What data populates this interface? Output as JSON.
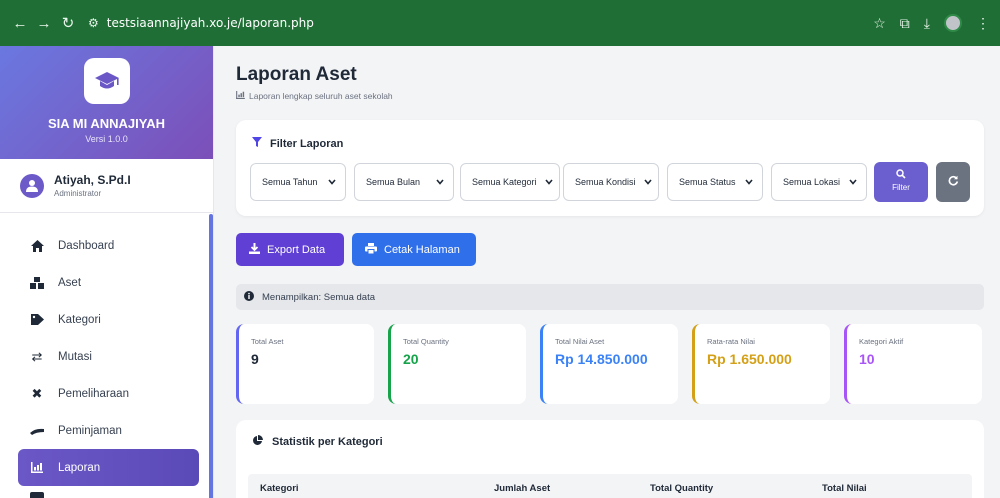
{
  "browser": {
    "url": "testsiaannajiyah.xo.je/laporan.php"
  },
  "sidebar": {
    "brand_name": "SIA MI ANNAJIYAH",
    "version": "Versi 1.0.0",
    "user_name": "Atiyah, S.Pd.I",
    "user_role": "Administrator",
    "menu": [
      {
        "label": "Dashboard",
        "icon": "home-icon"
      },
      {
        "label": "Aset",
        "icon": "boxes-icon"
      },
      {
        "label": "Kategori",
        "icon": "tag-icon"
      },
      {
        "label": "Mutasi",
        "icon": "exchange-icon"
      },
      {
        "label": "Pemeliharaan",
        "icon": "tools-icon"
      },
      {
        "label": "Peminjaman",
        "icon": "hand-icon"
      },
      {
        "label": "Laporan",
        "icon": "chart-icon"
      }
    ]
  },
  "page": {
    "title": "Laporan Aset",
    "subtitle": "Laporan lengkap seluruh aset sekolah"
  },
  "filter": {
    "title": "Filter Laporan",
    "selects": [
      "Semua Tahun",
      "Semua Bulan",
      "Semua Kategori",
      "Semua Kondisi",
      "Semua Status",
      "Semua Lokasi"
    ],
    "filter_button": "Filter"
  },
  "actions": {
    "export": "Export Data",
    "print": "Cetak Halaman"
  },
  "info": "Menampilkan: Semua data",
  "stats": [
    {
      "label": "Total Aset",
      "value": "9",
      "color": "#6366f1"
    },
    {
      "label": "Total Quantity",
      "value": "20",
      "color": "#16a34a"
    },
    {
      "label": "Total Nilai Aset",
      "value": "Rp 14.850.000",
      "color": "#3b82f6"
    },
    {
      "label": "Rata-rata Nilai",
      "value": "Rp 1.650.000",
      "color": "#d4a017"
    },
    {
      "label": "Kategori Aktif",
      "value": "10",
      "color": "#a855f7"
    }
  ],
  "category_stats": {
    "title": "Statistik per Kategori",
    "columns": [
      "Kategori",
      "Jumlah Aset",
      "Total Quantity",
      "Total Nilai"
    ]
  }
}
